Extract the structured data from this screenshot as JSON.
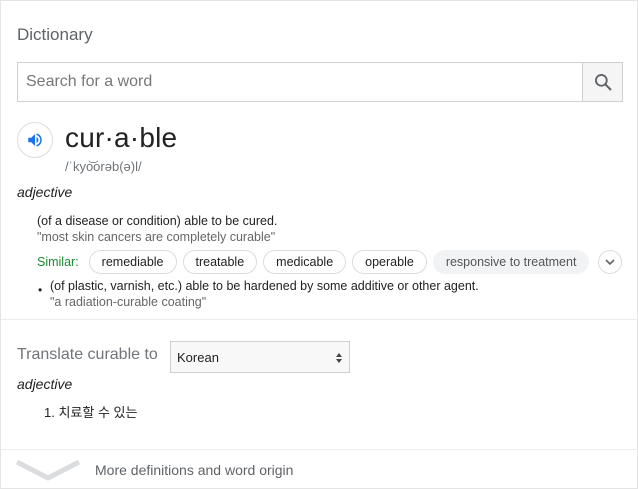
{
  "header": {
    "title": "Dictionary"
  },
  "search": {
    "placeholder": "Search for a word",
    "button_icon": "search-icon"
  },
  "entry": {
    "headword": "cur·a·ble",
    "phonetic": "/ˈkyo͝orəb(ə)l/",
    "part_of_speech": "adjective",
    "senses": [
      {
        "definition": "(of a disease or condition) able to be cured.",
        "example": "\"most skin cancers are completely curable\"",
        "similar_label": "Similar:",
        "similar": [
          "remediable",
          "treatable",
          "medicable",
          "operable",
          "responsive to treatment"
        ]
      },
      {
        "bullet": "•",
        "definition": "(of plastic, varnish, etc.) able to be hardened by some additive or other agent.",
        "example": "\"a radiation-curable coating\""
      }
    ]
  },
  "translate": {
    "label": "Translate curable to",
    "selected_language": "Korean",
    "part_of_speech": "adjective",
    "items": [
      "1. 치료할 수 있는"
    ]
  },
  "footer": {
    "more_label": "More definitions and word origin"
  },
  "colors": {
    "similar_label": "#1a8a2d",
    "speaker_icon": "#1a73e8"
  }
}
